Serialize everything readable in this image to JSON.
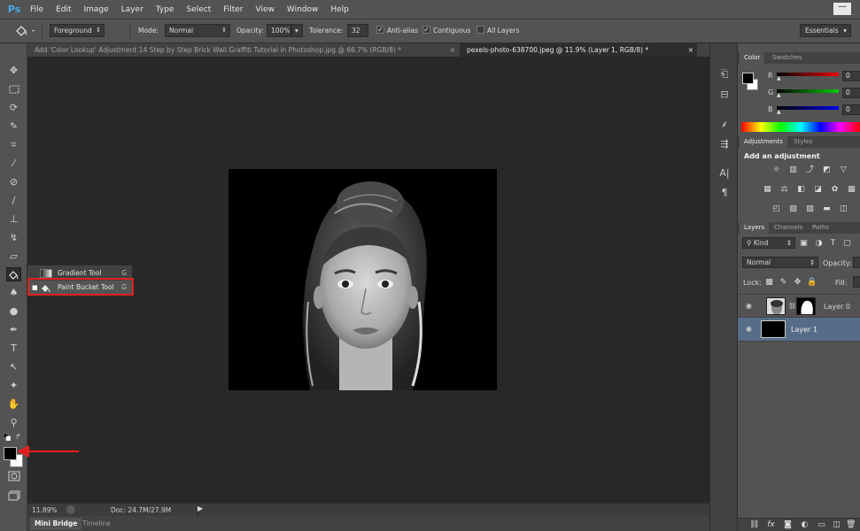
{
  "app": {
    "logo": "Ps",
    "min_button": "—"
  },
  "menu": [
    "File",
    "Edit",
    "Image",
    "Layer",
    "Type",
    "Select",
    "Filter",
    "View",
    "Window",
    "Help"
  ],
  "options": {
    "fill_source": "Foreground",
    "mode_label": "Mode:",
    "mode_value": "Normal",
    "opacity_label": "Opacity:",
    "opacity_value": "100%",
    "tolerance_label": "Tolerance:",
    "tolerance_value": "32",
    "antialias_label": "Anti-alias",
    "contiguous_label": "Contiguous",
    "all_layers_label": "All Layers",
    "workspace": "Essentials"
  },
  "tabs": [
    {
      "label": "Add 'Color Lookup' Adjustment 14 Step by Step Brick Wall Graffiti Tutorial in Photoshop.jpg @ 66.7% (RGB/8) *",
      "close": "×"
    },
    {
      "label": "pexels-photo-638700.jpeg @ 11.9% (Layer 1, RGB/8) *",
      "close": "×"
    }
  ],
  "flyout": {
    "items": [
      {
        "label": "Gradient Tool",
        "key": "G"
      },
      {
        "label": "Paint Bucket Tool",
        "key": "G"
      }
    ]
  },
  "status": {
    "zoom": "11.89%",
    "doc": "Doc: 24.7M/27.9M"
  },
  "bottom_tabs": [
    "Mini Bridge",
    "Timeline"
  ],
  "color_panel": {
    "tabs": [
      "Color",
      "Swatches"
    ],
    "channels": [
      {
        "name": "R",
        "value": "0"
      },
      {
        "name": "G",
        "value": "0"
      },
      {
        "name": "B",
        "value": "0"
      }
    ]
  },
  "adjustments_panel": {
    "tabs": [
      "Adjustments",
      "Styles"
    ],
    "heading": "Add an adjustment"
  },
  "layers_panel": {
    "tabs": [
      "Layers",
      "Channels",
      "Paths"
    ],
    "kind": "Kind",
    "blend_mode": "Normal",
    "opacity_label": "Opacity:",
    "lock_label": "Lock:",
    "fill_label": "Fill:",
    "layers": [
      {
        "name": "Layer 0"
      },
      {
        "name": "Layer 1"
      }
    ],
    "bottom_icons": [
      "link-icon",
      "fx-icon",
      "mask-icon",
      "adjustment-icon",
      "group-icon",
      "new-layer-icon",
      "trash-icon"
    ]
  },
  "colors": {
    "highlight": "#e02020",
    "foreground": "#000000",
    "background": "#ffffff",
    "selected_layer": "#566d89"
  }
}
